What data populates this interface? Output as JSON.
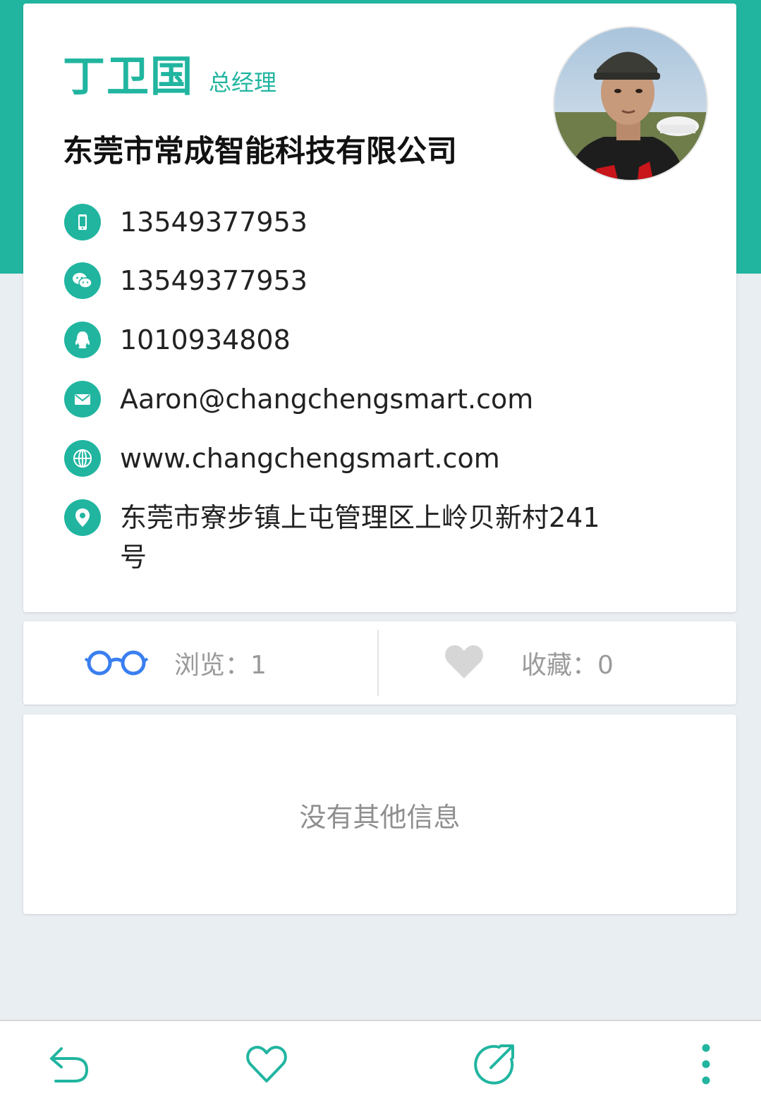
{
  "profile": {
    "name": "丁卫国",
    "title": "总经理",
    "company": "东莞市常成智能科技有限公司",
    "avatar_icon": "person-avatar-photo"
  },
  "contacts": [
    {
      "icon": "phone-icon",
      "value": "13549377953"
    },
    {
      "icon": "wechat-icon",
      "value": "13549377953"
    },
    {
      "icon": "qq-icon",
      "value": "1010934808"
    },
    {
      "icon": "mail-icon",
      "value": "Aaron@changchengsmart.com"
    },
    {
      "icon": "globe-icon",
      "value": "www.changchengsmart.com"
    },
    {
      "icon": "location-pin-icon",
      "value": "东莞市寮步镇上屯管理区上岭贝新村241号"
    }
  ],
  "stats": {
    "views_label": "浏览：1",
    "favorites_label": "收藏：0"
  },
  "empty_message": "没有其他信息",
  "bottom_bar": {
    "back_icon": "back-arrow-icon",
    "favorite_icon": "heart-icon",
    "share_icon": "share-icon",
    "more_icon": "more-vertical-icon"
  },
  "colors": {
    "accent": "#21b5a0",
    "background": "#e9eef2",
    "views_icon": "#3a7ff0",
    "heart_grey": "#d6d6d6"
  }
}
